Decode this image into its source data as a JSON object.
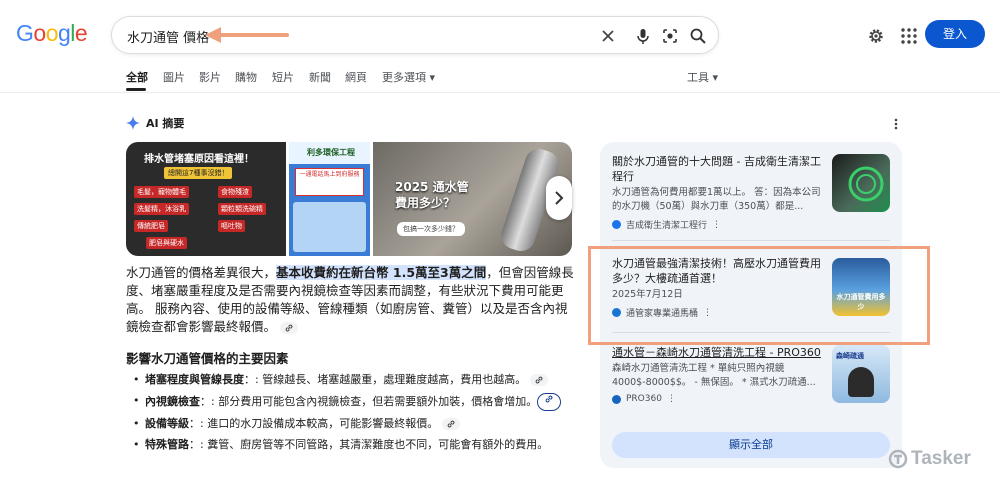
{
  "logo": {
    "letters": [
      "G",
      "o",
      "o",
      "g",
      "l",
      "e"
    ],
    "colors": [
      "#4285f4",
      "#ea4335",
      "#fbbc05",
      "#4285f4",
      "#34a853",
      "#ea4335"
    ]
  },
  "search": {
    "query": "水刀通管 價格"
  },
  "header": {
    "signin_label": "登入",
    "accent": "#0b57d0"
  },
  "tabs": [
    {
      "label": "全部",
      "active": true
    },
    {
      "label": "圖片"
    },
    {
      "label": "影片"
    },
    {
      "label": "購物"
    },
    {
      "label": "短片"
    },
    {
      "label": "新聞"
    },
    {
      "label": "網頁"
    },
    {
      "label": "更多選項 ▾"
    }
  ],
  "tools_label": "工具 ▾",
  "ai": {
    "heading": "AI 摘要",
    "images": {
      "img1_title": "排水管堵塞原因看這裡！",
      "img1_sub": "總開這7種事沒錯！",
      "img1_chips": [
        "毛髮，寵物體毛",
        "食物殘渣",
        "洗髮精，沐浴乳",
        "顆粒類洗碗精",
        "傳統肥皂",
        "嘔吐物",
        "肥皂與硬水"
      ],
      "img2_title": "利多環保工程",
      "img2_red": "一通電話馬上到府服務",
      "img3_title1": "2025 通水管",
      "img3_title2": "費用多少？",
      "img3_tag": "包搞一次多少錢？"
    },
    "answer": {
      "part1": "水刀通管的價格差異很大，",
      "highlight": "基本收費約在新台幣 1.5萬至3萬之間",
      "part2": "，但會因管線長度、堵塞嚴重程度及是否需要內視鏡檢查等因素而調整，有些狀況下費用可能更高。 服務內容、使用的設備等級、管線種類（如廚房管、糞管）以及是否含內視鏡檢查都會影響最終報價。"
    },
    "subheading": "影響水刀通管價格的主要因素",
    "bullets": [
      {
        "term": "堵塞程度與管線長度",
        "text": "：: 管線越長、堵塞越嚴重，處理難度越高，費用也越高。"
      },
      {
        "term": "內視鏡檢查",
        "text": "：: 部分費用可能包含內視鏡檢查，但若需要額外加裝，價格會增加。"
      },
      {
        "term": "設備等級",
        "text": "：: 進口的水刀設備成本較高，可能影響最終報價。"
      },
      {
        "term": "特殊管路",
        "text": "：: 糞管、廚房管等不同管路，其清潔難度也不同，可能會有額外的費用。"
      }
    ]
  },
  "sources": [
    {
      "title": "關於水刀通管的十大問題 - 吉成衛生清潔工程行",
      "snippet": "水刀通管為何費用都要1萬以上。 答：因為本公司的水刀機（50萬）與水刀車（350萬）都是...",
      "site": "吉成衛生清潔工程行"
    },
    {
      "title": "水刀通管最強清潔技術！高壓水刀通管費用多少？大樓疏通首選！",
      "date": "2025年7月12日",
      "site": "通管家專業通馬桶",
      "thumb_text": "水刀通管費用多少"
    },
    {
      "title": "通水管－森崎水刀通管清洗工程 - PRO360",
      "snippet": "森崎水刀通管清洗工程 * 單純只照內視鏡 4000$-8000$$。 - 無保固。 * 濕式水刀疏通...",
      "site": "PRO360",
      "thumb_text": "森崎疏通"
    }
  ],
  "show_all_label": "顯示全部",
  "watermark": "Tasker"
}
